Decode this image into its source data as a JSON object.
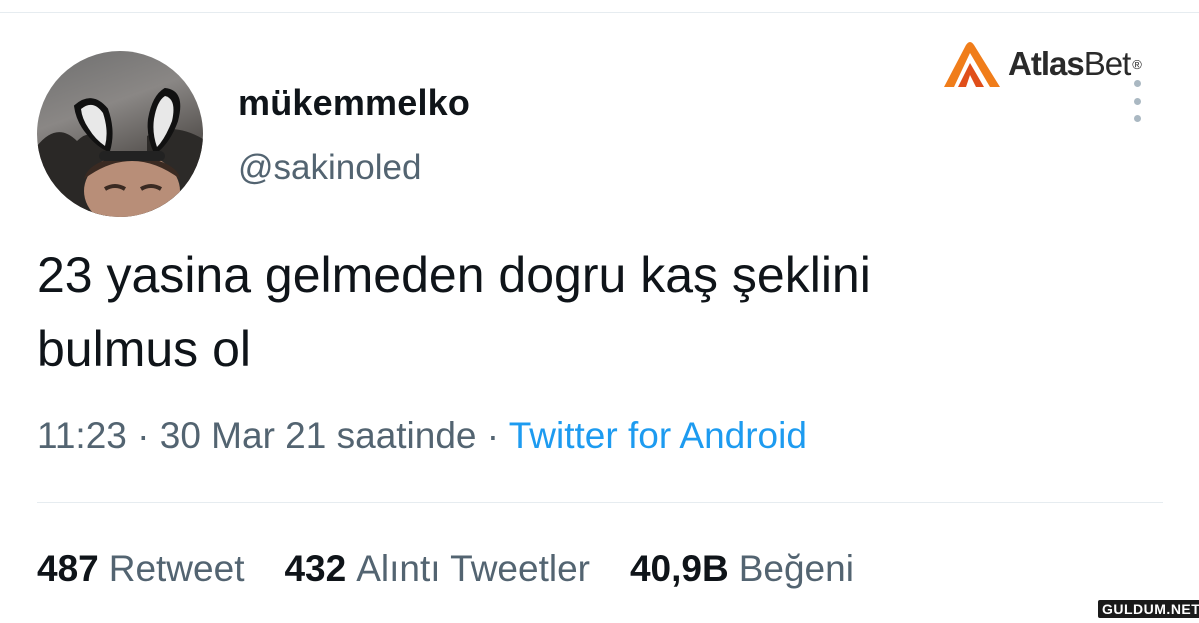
{
  "user": {
    "display_name": "mükemmelko",
    "handle": "@sakinoled"
  },
  "brand": {
    "name_bold": "Atlas",
    "name_thin": "Bet",
    "reg": "®"
  },
  "tweet": {
    "text_line1": "23 yasina gelmeden dogru kaş şeklini",
    "text_line2": "bulmus ol",
    "time": "11:23",
    "sep1": " · ",
    "date": "30 Mar 21 saatinde",
    "sep2": " · ",
    "source": "Twitter for Android"
  },
  "stats": [
    {
      "num": "487",
      "label": "Retweet"
    },
    {
      "num": "432",
      "label": "Alıntı Tweetler"
    },
    {
      "num": "40,9B",
      "label": "Beğeni"
    }
  ],
  "watermark": "GULDUM.NET",
  "colors": {
    "text": "#0f1419",
    "secondary": "#536471",
    "link": "#1d9bf0",
    "divider": "#e6ecf0",
    "brand_orange": "#f07d1a"
  }
}
